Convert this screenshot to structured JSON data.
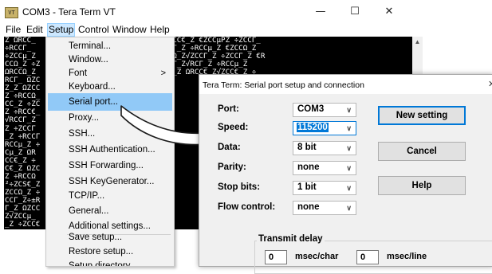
{
  "window": {
    "icon_text": "VT",
    "title": "COM3 - Tera Term VT",
    "minimize": "—",
    "maximize": "☐",
    "close": "✕"
  },
  "menubar": {
    "file": "File",
    "edit": "Edit",
    "setup": "Setup",
    "control": "Control",
    "window": "Window",
    "help": "Help"
  },
  "terminal": {
    "lines": [
      "Z ΩRCC_    Z ΩRCC_Z ÷RCCμ_Z ÷RCCΓ_Z ΩRCC€_Z €ZCCμPZ ÷ZCCΓ_",
      "÷RCCΓ_     €ZCCμ_Z ÷RCCμ_Z ÷ZCCμ_Z ÷RCΓ_Z ÷RCCμ_Z €ZCCΩ_Z",
      "÷ZCCμ_Z    ZCC€_Z ÷ZCCΩ_Z ÷ZCCΓ_Z █RCCΩ_Z√ZCCΓ_Z ÷ZCCΓ_Z €R",
      "CCΩ_Z ÷Z   ZCCμ_Z ÷ZCC€_Z ÷ZCCΓ_Z ÷RCCΓ_Z√RCΓ_Z ÷RCCμ_Z",
      "ΩRCCΩ_Z    ZCCΓ_Z ÷RCCΩ_Z ÷RCΓ_Z ΩRCCμ_Z ΩRCC€_Z√ZCC€_Z ÷",
      "RCΓ_ ΩZC   RCCμ_Z ÷ZC",
      "Z_Z ΩZCC   ZCC€_Z ÷RC",
      "Z ÷RCCΩ_   RCCΓ_Z ÷R",
      "CC_Z ÷ZC   ZCCμ_Z ÷Z",
      "Z ÷RCC€_   ZCCΓ_Z ÷R",
      "√RCCΓ_Z    RCC€_Z",
      "Z ÷ZCCΓ    ZCCΩ_Z",
      "_Z ÷RCCΓ   ZCCμ_Z",
      "RCCμ_Z ÷   RCC€_Z",
      "Cμ_Z ΩR    μ_Z ÷",
      "CC€_Z ÷    ZCCμ_Z",
      "C€_Z ΩZC   CCΓ_Z",
      "Z ÷RCCΩ    RCCμ_Z",
      "²÷ZCS€_Z   ZCC€_Z",
      "ZCCΩ_Z ÷   ZCCΓ_Z",
      "CCΓ_Z÷±R   μ_Z¥",
      "Γ_Z ΩZCC   RCCμ_Z",
      "Z√ZCCμ_    ZCC€_Z",
      "_Z ÷ZCC€   Z ÷ZCC"
    ]
  },
  "setup_menu": {
    "items": [
      "Terminal...",
      "Window...",
      "Font",
      "Keyboard...",
      "Serial port...",
      "Proxy...",
      "SSH...",
      "SSH Authentication...",
      "SSH Forwarding...",
      "SSH KeyGenerator...",
      "TCP/IP...",
      "General...",
      "Additional settings...",
      "Save setup...",
      "Restore setup...",
      "Setup directory..."
    ],
    "font_arrow": ">",
    "highlighted_index": 4
  },
  "dialog": {
    "title": "Tera Term: Serial port setup and connection",
    "close": "✕",
    "port_label": "Port:",
    "port_value": "COM3",
    "speed_label": "Speed:",
    "speed_value": "115200",
    "data_label": "Data:",
    "data_value": "8 bit",
    "parity_label": "Parity:",
    "parity_value": "none",
    "stop_label": "Stop bits:",
    "stop_value": "1 bit",
    "flow_label": "Flow control:",
    "flow_value": "none",
    "new_setting": "New setting",
    "cancel": "Cancel",
    "help": "Help",
    "transmit_delay": "Transmit delay",
    "char_delay": "0",
    "char_unit": "msec/char",
    "line_delay": "0",
    "line_unit": "msec/line",
    "combo_arrow": "∨"
  },
  "colors": {
    "highlight": "#91c9f7",
    "selection": "#0078d7",
    "terminal_bg": "#000000"
  }
}
